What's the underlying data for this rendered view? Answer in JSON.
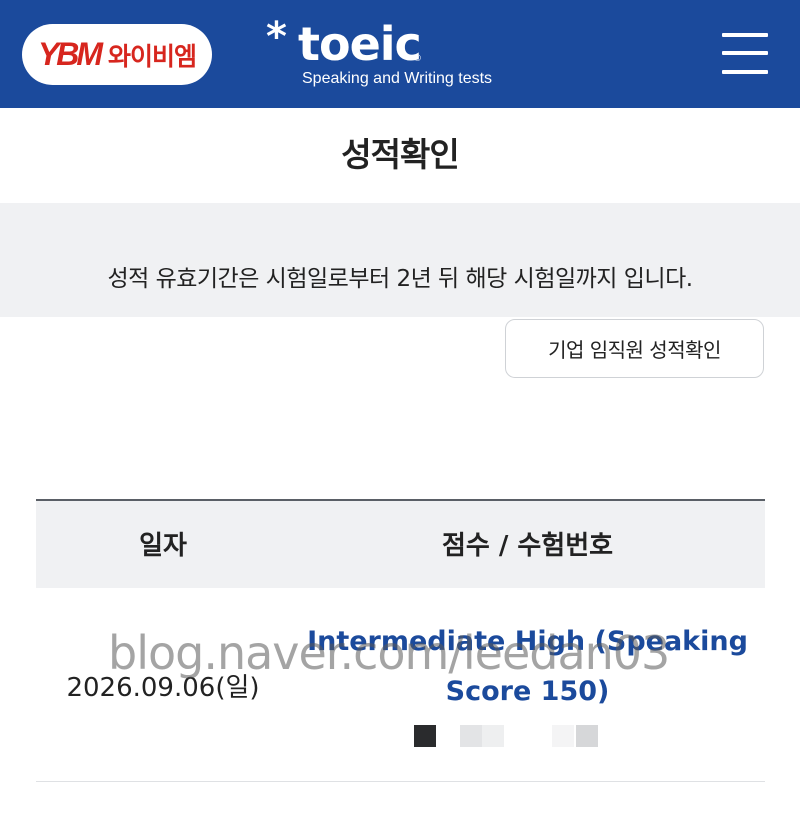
{
  "header": {
    "brand_logo": "YBM 와이비엠",
    "toeic_wordmark": "toeic",
    "toeic_subtitle": "Speaking and Writing tests",
    "menu_icon": "hamburger-menu-icon",
    "background_color": "#1b4a9c"
  },
  "page": {
    "title": "성적확인",
    "notice": "성적 유효기간은 시험일로부터 2년 뒤 해당 시험일까지 입니다.",
    "corporate_button_label": "기업 임직원 성적확인"
  },
  "table": {
    "headers": [
      "일자",
      "점수 / 수험번호"
    ],
    "rows": [
      {
        "date": "2026.09.06(일)",
        "score": "Intermediate High (Speaking Score 150)",
        "exam_number": "redacted"
      }
    ]
  },
  "watermark": "blog.naver.com/leedan03",
  "colors": {
    "accent": "#1b4a9c",
    "brand_red": "#d7261e",
    "panel_gray": "#f0f1f3"
  }
}
